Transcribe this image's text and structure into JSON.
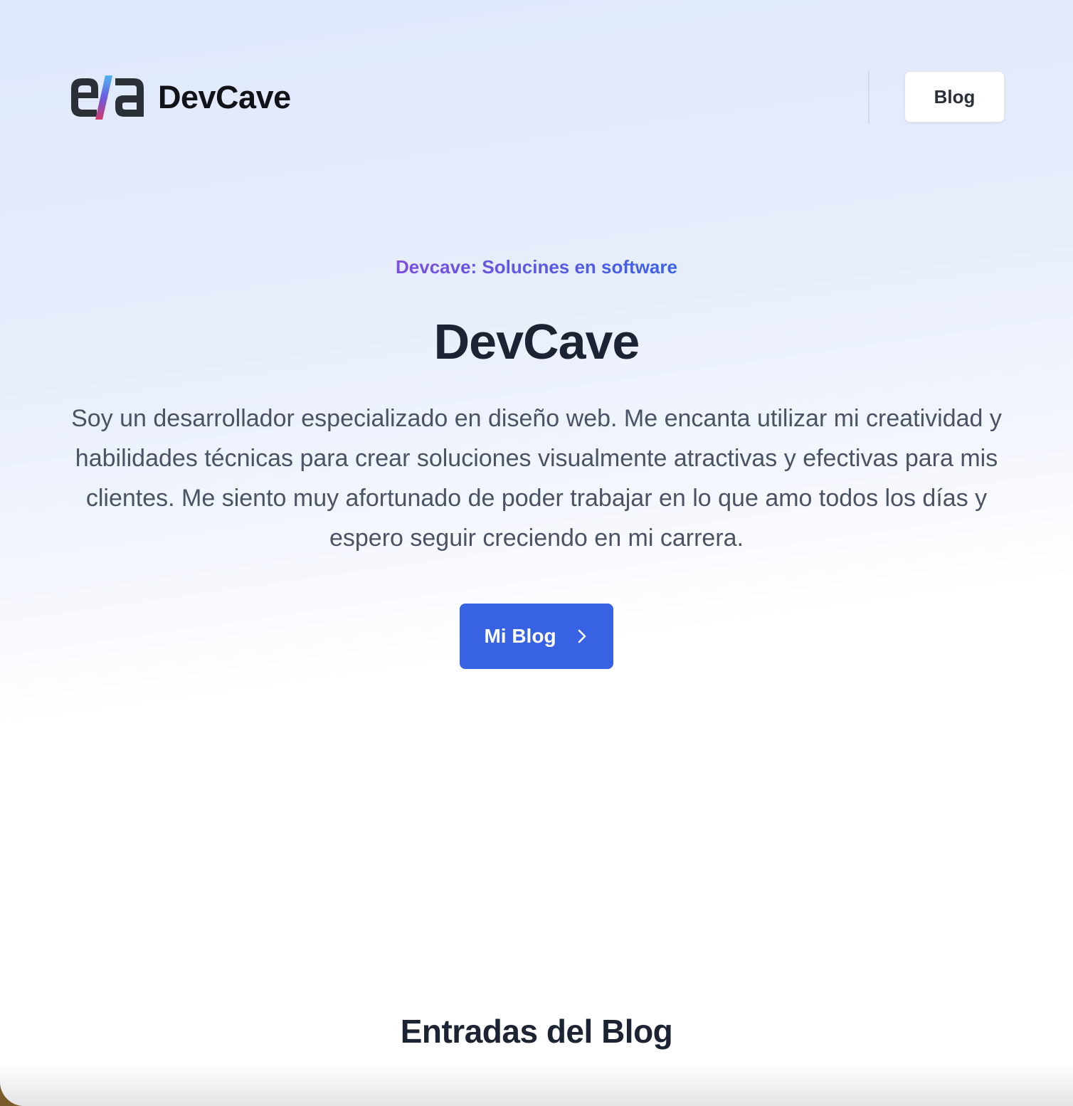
{
  "header": {
    "logo_text": "DevCave",
    "logo_icon": "e/a-logo-icon",
    "nav": {
      "blog_label": "Blog"
    }
  },
  "hero": {
    "tagline": "Devcave: Solucines en software",
    "title": "DevCave",
    "description": "Soy un desarrollador especializado en diseño web. Me encanta utilizar mi creatividad y habilidades técnicas para crear soluciones visualmente atractivas y efectivas para mis clientes. Me siento muy afortunado de poder trabajar en lo que amo todos los días y espero seguir creciendo en mi carrera.",
    "cta_label": "Mi Blog",
    "cta_icon": "chevron-right-icon"
  },
  "blog_section": {
    "title": "Entradas del Blog"
  },
  "colors": {
    "accent": "#3862e4",
    "tagline_start": "#7c4fe0",
    "tagline_end": "#3a62e8",
    "heading": "#1c2433",
    "body_text": "#4a5263"
  }
}
